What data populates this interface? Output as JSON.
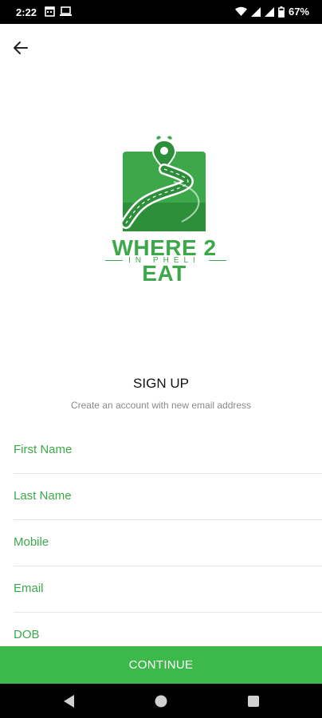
{
  "status_bar": {
    "time": "2:22",
    "battery": "67%"
  },
  "logo": {
    "title": "WHERE 2 EAT",
    "subtitle": "IN PHELI"
  },
  "header": {
    "title": "SIGN UP",
    "subtitle": "Create an account with new email address"
  },
  "form": {
    "fields": [
      {
        "label": "First Name"
      },
      {
        "label": "Last Name"
      },
      {
        "label": "Mobile"
      },
      {
        "label": "Email"
      },
      {
        "label": "DOB"
      }
    ]
  },
  "actions": {
    "continue_label": "CONTINUE"
  },
  "colors": {
    "accent": "#3da84a",
    "button": "#3db84a",
    "bars": "#000000"
  }
}
